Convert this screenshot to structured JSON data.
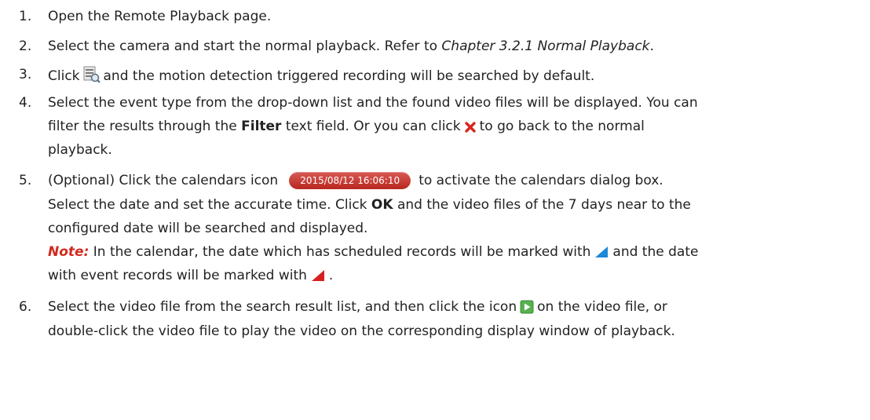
{
  "steps": [
    {
      "num": "1.",
      "text": "Open the Remote Playback page."
    },
    {
      "num": "2.",
      "text_a": "Select the camera and start the normal playback. Refer to ",
      "ref": "Chapter 3.2.1 Normal Playback",
      "text_b": "."
    },
    {
      "num": "3.",
      "text_a": "Click",
      "icon": "search-files-icon",
      "text_b": "and the motion detection triggered recording will be searched by default."
    },
    {
      "num": "4.",
      "line1": "Select the event type from the drop-down list and the found video files will be displayed. You can",
      "l2_a": "filter the results through the ",
      "l2_bold": "Filter",
      "l2_b": " text field. Or you can click",
      "icon": "close-red-x-icon",
      "l2_c": "to go back to the normal",
      "line3": "playback."
    },
    {
      "num": "5.",
      "l1_a": "(Optional) Click the calendars icon",
      "time_value": "2015/08/12 16:06:10",
      "l1_b": "to activate the calendars dialog box.",
      "l2_a": "Select the date and set the accurate time. Click ",
      "l2_bold": "OK",
      "l2_b": " and the video files of the 7 days near to the",
      "line3": "configured date will be searched and displayed.",
      "note_label": "Note:",
      "note_a": " In the calendar, the date which has scheduled records will be marked with",
      "note_b": "and the date",
      "note_c": "with event records will be marked with",
      "note_d": "."
    },
    {
      "num": "6.",
      "l1_a": "Select the video file from the search result list, and then click the icon",
      "icon": "play-icon",
      "l1_b": "on the video file, or",
      "line2": "double-click the video file to play the video on the corresponding display window of playback."
    }
  ],
  "colors": {
    "note": "#d02a1f",
    "time_bar": "#c43a33",
    "scheduled_marker": "#1e88d6",
    "event_marker": "#d62020"
  }
}
